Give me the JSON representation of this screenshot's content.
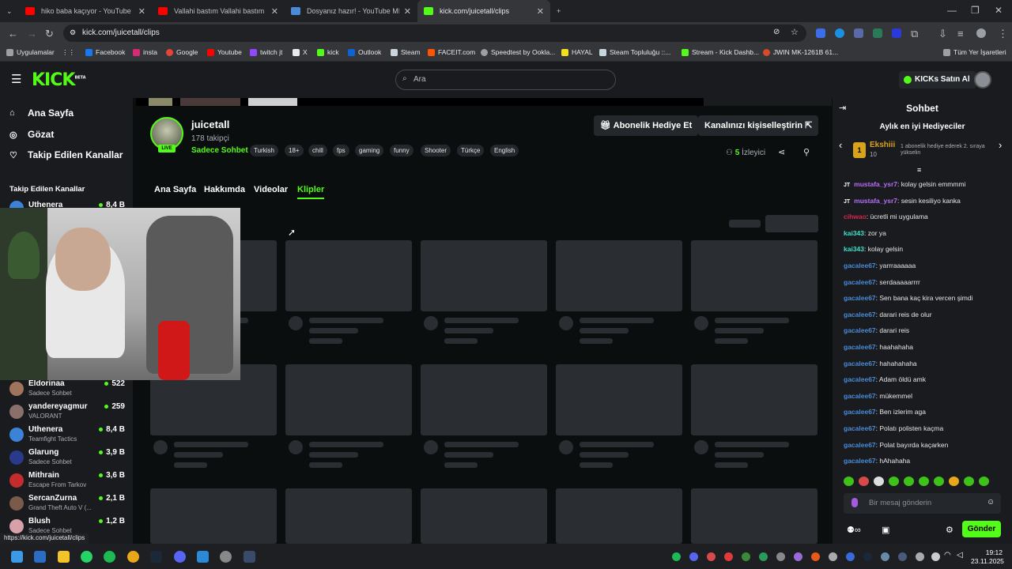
{
  "browser": {
    "tabs": [
      {
        "label": "hiko baba kaçıyor - YouTube",
        "color": "#ff0000"
      },
      {
        "label": "Vallahi bastım Vallahi bastım ka",
        "color": "#ff0000"
      },
      {
        "label": "Dosyanız hazır! - YouTube MP3",
        "color": "#4a8bd8"
      },
      {
        "label": "kick.com/juicetall/clips",
        "color": "#53fc18"
      }
    ],
    "url": "kick.com/juicetall/clips",
    "bookmarks": {
      "apps": "Uygulamalar",
      "items": [
        "Facebook",
        "insta",
        "Google",
        "Youtube",
        "twitch jt",
        "X",
        "kick",
        "Outlook",
        "Steam",
        "FACEIT.com",
        "Speedtest by Ookla...",
        "HAYAL",
        "Steam Topluluğu ::...",
        "Stream - Kick Dashb...",
        "JWIN MK-1261B 61..."
      ],
      "all": "Tüm Yer İşaretleri"
    },
    "status_url": "https://kick.com/juicetall/clips"
  },
  "kick": {
    "logo": "KICK",
    "logo_beta": "BETA",
    "search_placeholder": "Ara",
    "buy_kicks": "KICKs Satın Al",
    "brand_color": "#53fc18",
    "sidebar": {
      "home": "Ana Sayfa",
      "browse": "Gözat",
      "following": "Takip Edilen Kanallar",
      "section_title": "Takip Edilen Kanallar",
      "channels": [
        {
          "name": "Uthenera",
          "category": "",
          "viewers": "8,4 B",
          "color": "#3c83d8"
        },
        {
          "name": "Eldorinaa",
          "category": "Sadece Sohbet",
          "viewers": "522",
          "color": "#a0745a"
        },
        {
          "name": "yandereyagmur",
          "category": "VALORANT",
          "viewers": "259",
          "color": "#8a6f6a"
        },
        {
          "name": "Uthenera",
          "category": "Teamfight Tactics",
          "viewers": "8,4 B",
          "color": "#3c83d8"
        },
        {
          "name": "Glarung",
          "category": "Sadece Sohbet",
          "viewers": "3,9 B",
          "color": "#2a3a8a"
        },
        {
          "name": "Mithrain",
          "category": "Escape From Tarkov",
          "viewers": "3,6 B",
          "color": "#c42d2d"
        },
        {
          "name": "SercanZurna",
          "category": "Grand Theft Auto V (...",
          "viewers": "2,1 B",
          "color": "#7a5a4a"
        },
        {
          "name": "Blush",
          "category": "Sadece Sohbet",
          "viewers": "1,2 B",
          "color": "#d8a0a8"
        }
      ]
    },
    "channel": {
      "name": "juicetall",
      "followers": "178 takipçi",
      "category": "Sadece Sohbet",
      "live": "LIVE",
      "tags": [
        "Turkish",
        "18+",
        "chill",
        "fps",
        "gaming",
        "funny",
        "Shooter",
        "Türkçe",
        "English"
      ],
      "gift_sub": "Abonelik Hediye Et",
      "customize": "Kanalınızı kişiselleştirin",
      "viewers_count": "5",
      "viewers_label": "İzleyici",
      "tabs": [
        "Ana Sayfa",
        "Hakkımda",
        "Videolar",
        "Klipler"
      ],
      "active_tab": "Klipler"
    },
    "chat": {
      "title": "Sohbet",
      "top_gifters_title": "Aylık en iyi Hediyeciler",
      "top_gifter": {
        "rank": "1",
        "name": "Ekshiii",
        "count": "10",
        "hint": "1 abonelik hediye ederek 2. sıraya yükselin"
      },
      "messages": [
        {
          "user": "mustafa_ysr7",
          "text": "kolay gelsin emmmmi",
          "color": "#b76ef5",
          "badge": "JT"
        },
        {
          "user": "mustafa_ysr7",
          "text": "sesin kesiliyo kanka",
          "color": "#b76ef5",
          "badge": "JT"
        },
        {
          "user": "cihwao",
          "text": "ücretli mi uygulama",
          "color": "#d8254d",
          "badge": ""
        },
        {
          "user": "kai343",
          "text": "zor ya",
          "color": "#3ee0c8",
          "badge": ""
        },
        {
          "user": "kai343",
          "text": "kolay gelsin",
          "color": "#3ee0c8",
          "badge": ""
        },
        {
          "user": "gacalee67",
          "text": "yarrraaaaaa",
          "color": "#4a8bd8",
          "badge": ""
        },
        {
          "user": "gacalee67",
          "text": "serdaaaaarrrr",
          "color": "#4a8bd8",
          "badge": ""
        },
        {
          "user": "gacalee67",
          "text": "Sen bana kaç kira vercen şimdi",
          "color": "#4a8bd8",
          "badge": ""
        },
        {
          "user": "gacalee67",
          "text": "darari reis de olur",
          "color": "#4a8bd8",
          "badge": ""
        },
        {
          "user": "gacalee67",
          "text": "darari reis",
          "color": "#4a8bd8",
          "badge": ""
        },
        {
          "user": "gacalee67",
          "text": "haahahaha",
          "color": "#4a8bd8",
          "badge": ""
        },
        {
          "user": "gacalee67",
          "text": "hahahahaha",
          "color": "#4a8bd8",
          "badge": ""
        },
        {
          "user": "gacalee67",
          "text": "Adam öldü amk",
          "color": "#4a8bd8",
          "badge": ""
        },
        {
          "user": "gacalee67",
          "text": "mükemmel",
          "color": "#4a8bd8",
          "badge": ""
        },
        {
          "user": "gacalee67",
          "text": "Ben izlerim aga",
          "color": "#4a8bd8",
          "badge": ""
        },
        {
          "user": "gacalee67",
          "text": "Polatı polisten kaçma",
          "color": "#4a8bd8",
          "badge": ""
        },
        {
          "user": "gacalee67",
          "text": "Polat bayırda kaçarken",
          "color": "#4a8bd8",
          "badge": ""
        },
        {
          "user": "gacalee67",
          "text": "hAhahaha",
          "color": "#4a8bd8",
          "badge": ""
        }
      ],
      "input_placeholder": "Bir mesaj gönderin",
      "send": "Gönder"
    }
  },
  "taskbar": {
    "time": "19:12",
    "date": "23.11.2025"
  }
}
